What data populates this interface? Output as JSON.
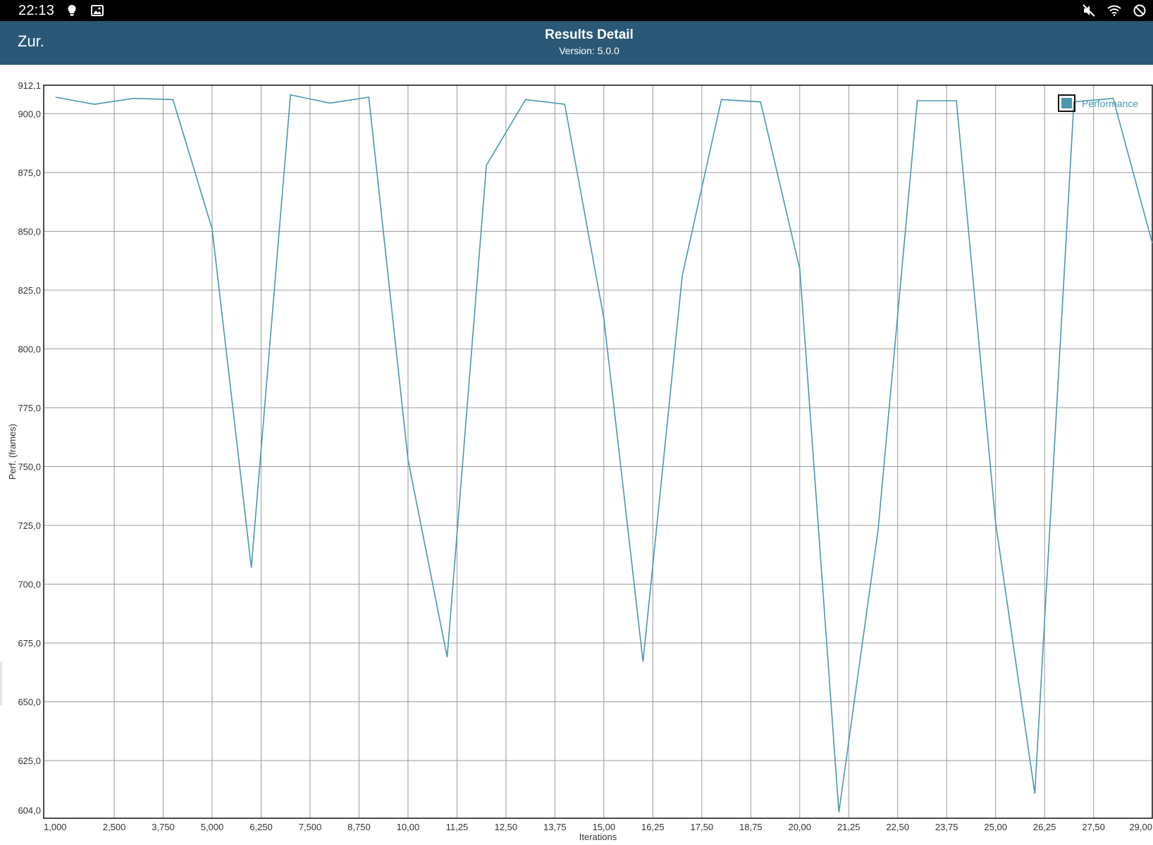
{
  "status_bar": {
    "time": "22:13",
    "left_icons": [
      "bulb-icon",
      "image-icon"
    ],
    "right_icons": [
      "mute-icon",
      "wifi-icon",
      "do-not-disturb-icon"
    ]
  },
  "app_bar": {
    "back_label": "Zur.",
    "title": "Results Detail",
    "subtitle": "Version: 5.0.0",
    "background_color": "#2b5876"
  },
  "chart_data": {
    "type": "line",
    "title": "",
    "xlabel": "Iterations",
    "ylabel": "Perf. (frames)",
    "xlim": [
      0.7,
      29.0
    ],
    "ylim": [
      600.5,
      912.1
    ],
    "x_ticks": [
      {
        "value": 1.0,
        "label": "1,000"
      },
      {
        "value": 2.5,
        "label": "2,500"
      },
      {
        "value": 3.75,
        "label": "3,750"
      },
      {
        "value": 5.0,
        "label": "5,000"
      },
      {
        "value": 6.25,
        "label": "6,250"
      },
      {
        "value": 7.5,
        "label": "7,500"
      },
      {
        "value": 8.75,
        "label": "8,750"
      },
      {
        "value": 10.0,
        "label": "10,00"
      },
      {
        "value": 11.25,
        "label": "11,25"
      },
      {
        "value": 12.5,
        "label": "12,50"
      },
      {
        "value": 13.75,
        "label": "13,75"
      },
      {
        "value": 15.0,
        "label": "15,00"
      },
      {
        "value": 16.25,
        "label": "16,25"
      },
      {
        "value": 17.5,
        "label": "17,50"
      },
      {
        "value": 18.75,
        "label": "18,75"
      },
      {
        "value": 20.0,
        "label": "20,00"
      },
      {
        "value": 21.25,
        "label": "21,25"
      },
      {
        "value": 22.5,
        "label": "22,50"
      },
      {
        "value": 23.75,
        "label": "23,75"
      },
      {
        "value": 25.0,
        "label": "25,00"
      },
      {
        "value": 26.25,
        "label": "26,25"
      },
      {
        "value": 27.5,
        "label": "27,50"
      },
      {
        "value": 29.0,
        "label": "29,00"
      }
    ],
    "y_ticks": [
      {
        "value": 912.1,
        "label": "912,1"
      },
      {
        "value": 900.0,
        "label": "900,0"
      },
      {
        "value": 875.0,
        "label": "875,0"
      },
      {
        "value": 850.0,
        "label": "850,0"
      },
      {
        "value": 825.0,
        "label": "825,0"
      },
      {
        "value": 800.0,
        "label": "800,0"
      },
      {
        "value": 775.0,
        "label": "775,0"
      },
      {
        "value": 750.0,
        "label": "750,0"
      },
      {
        "value": 725.0,
        "label": "725,0"
      },
      {
        "value": 700.0,
        "label": "700,0"
      },
      {
        "value": 675.0,
        "label": "675,0"
      },
      {
        "value": 650.0,
        "label": "650,0"
      },
      {
        "value": 625.0,
        "label": "625,0"
      },
      {
        "value": 604.0,
        "label": "604,0"
      }
    ],
    "x_gridlines": [
      2.5,
      3.75,
      5.0,
      6.25,
      7.5,
      8.75,
      10.0,
      11.25,
      12.5,
      13.75,
      15.0,
      16.25,
      17.5,
      18.75,
      20.0,
      21.25,
      22.5,
      23.75,
      25.0,
      26.25,
      27.5
    ],
    "y_gridlines": [
      900,
      875,
      850,
      825,
      800,
      775,
      750,
      725,
      700,
      675,
      650,
      625
    ],
    "grid": true,
    "legend": {
      "position": "top-right"
    },
    "series": [
      {
        "name": "Performance",
        "color": "#4a97b0",
        "x": [
          1,
          2,
          3,
          4,
          5,
          6,
          7,
          8,
          9,
          10,
          11,
          12,
          13,
          14,
          15,
          16,
          17,
          18,
          19,
          20,
          21,
          22,
          23,
          24,
          25,
          26,
          27,
          28,
          29
        ],
        "y": [
          907,
          904,
          906.5,
          906,
          851,
          707,
          908,
          904.5,
          907,
          753,
          669,
          878,
          906,
          904,
          813,
          667,
          831,
          906,
          905,
          834,
          603,
          723,
          905.5,
          905.5,
          726,
          611,
          905,
          906.5,
          845
        ]
      }
    ]
  }
}
